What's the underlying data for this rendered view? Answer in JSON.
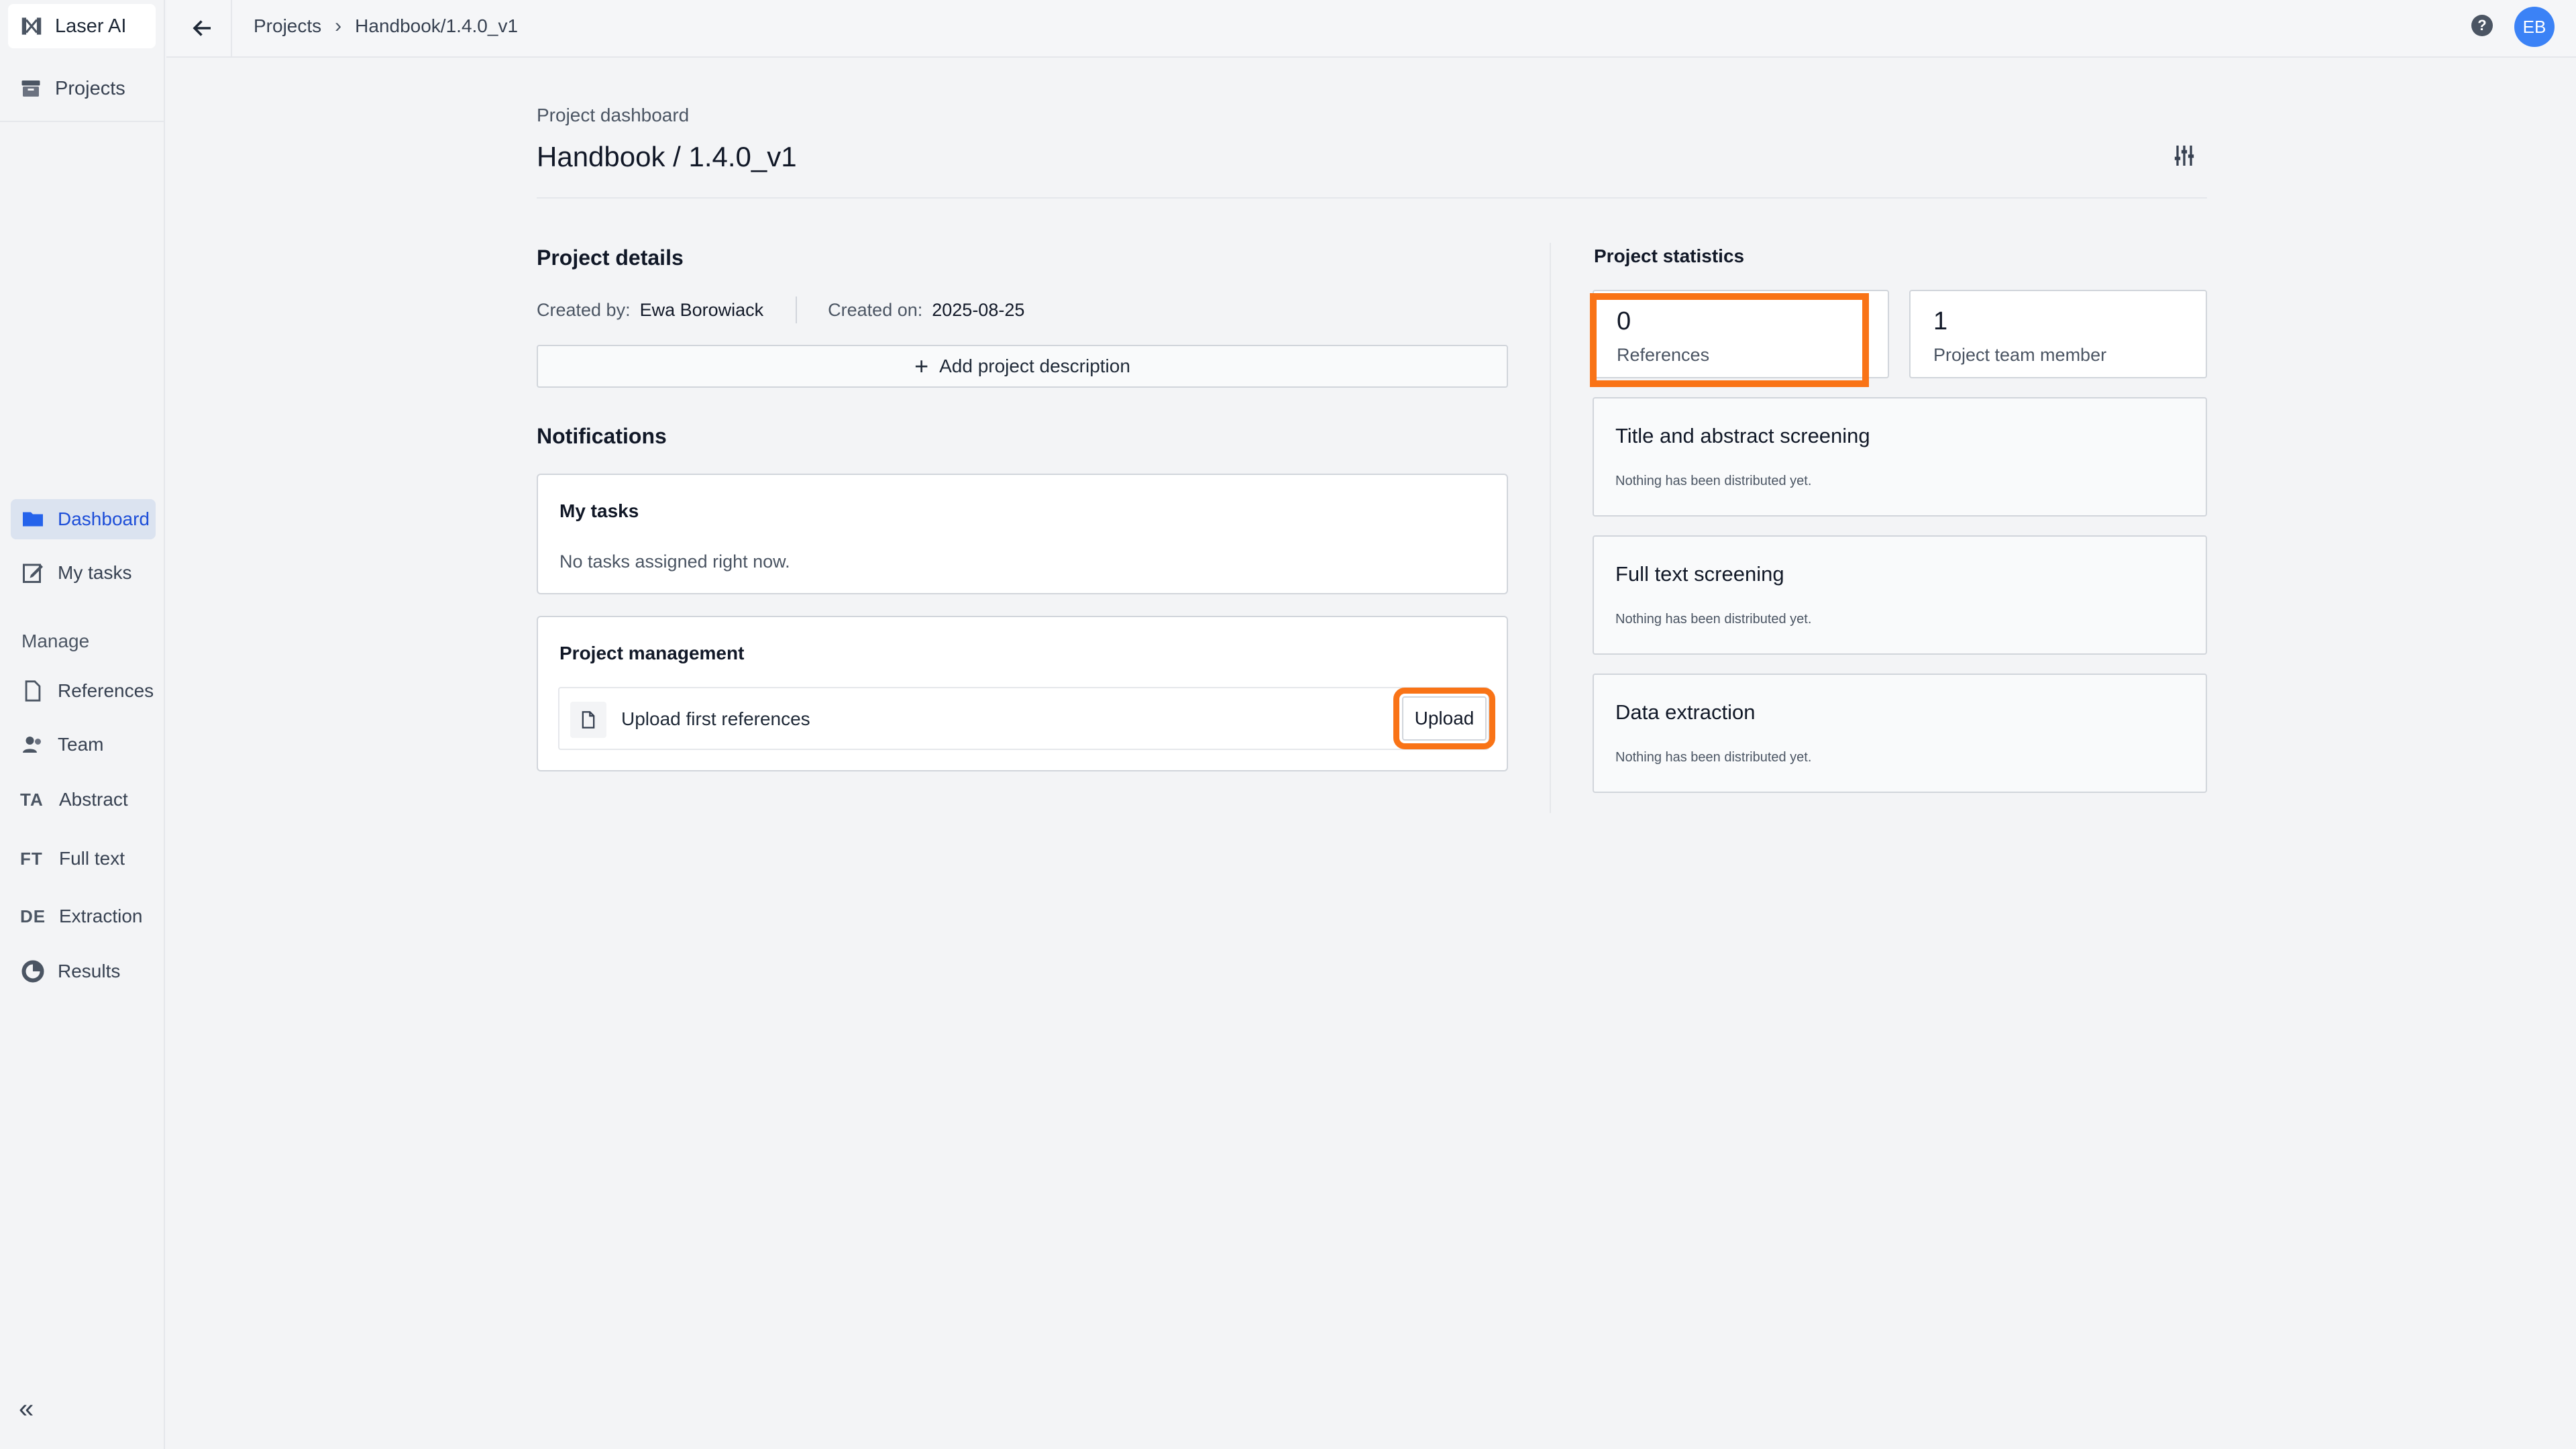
{
  "sidebar": {
    "brand": "Laser AI",
    "projects_label": "Projects",
    "nav": [
      {
        "label": "Dashboard",
        "icon": "folder-icon",
        "active": true
      },
      {
        "label": "My tasks",
        "icon": "edit-icon",
        "active": false
      }
    ],
    "manage_label": "Manage",
    "manage_items": [
      {
        "label": "References",
        "icon": "document-icon"
      },
      {
        "label": "Team",
        "icon": "team-icon"
      },
      {
        "label": "Abstract",
        "abbr": "TA"
      },
      {
        "label": "Full text",
        "abbr": "FT"
      },
      {
        "label": "Extraction",
        "abbr": "DE"
      },
      {
        "label": "Results",
        "icon": "results-icon"
      }
    ],
    "collapse_glyph": "«"
  },
  "topbar": {
    "breadcrumb": [
      "Projects",
      "Handbook/1.4.0_v1"
    ],
    "avatar_initials": "EB",
    "help_glyph": "?"
  },
  "header": {
    "eyebrow": "Project dashboard",
    "title": "Handbook / 1.4.0_v1"
  },
  "details": {
    "title": "Project details",
    "created_by_label": "Created by:",
    "created_by": "Ewa Borowiack",
    "created_on_label": "Created on:",
    "created_on": "2025-08-25",
    "add_description": "Add project description"
  },
  "notifications": {
    "title": "Notifications",
    "my_tasks_title": "My tasks",
    "my_tasks_empty": "No tasks assigned right now.",
    "management_title": "Project management",
    "upload_text": "Upload first references",
    "upload_button": "Upload"
  },
  "statistics": {
    "title": "Project statistics",
    "references_count": "0",
    "references_label": "References",
    "team_count": "1",
    "team_label": "Project team member",
    "phases": [
      {
        "title": "Title and abstract screening",
        "note": "Nothing has been distributed yet."
      },
      {
        "title": "Full text screening",
        "note": "Nothing has been distributed yet."
      },
      {
        "title": "Data extraction",
        "note": "Nothing has been distributed yet."
      }
    ]
  },
  "colors": {
    "accent": "#1d4ed8",
    "highlight": "#f97316",
    "avatar": "#3b82f6"
  }
}
